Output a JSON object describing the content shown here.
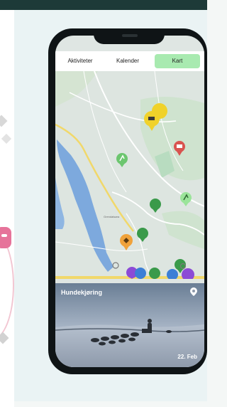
{
  "tabs": [
    {
      "label": "Aktiviteter",
      "active": false
    },
    {
      "label": "Kalender",
      "active": false
    },
    {
      "label": "Kart",
      "active": true
    }
  ],
  "map": {
    "road_label": "Grendalsøra",
    "markers": [
      {
        "icon": "event-pin-icon",
        "color": "#f0d22a"
      },
      {
        "icon": "food-pin-icon",
        "color": "#d9534f"
      },
      {
        "icon": "activity-pin-icon",
        "color": "#6cc66f"
      },
      {
        "icon": "activity-pin-icon",
        "color": "#9be49a"
      },
      {
        "icon": "activity-pin-icon",
        "color": "#3a9a4a"
      },
      {
        "icon": "activity-pin-icon",
        "color": "#3a9a4a"
      },
      {
        "icon": "orange-pin-icon",
        "color": "#f0a23a"
      },
      {
        "icon": "activity-pin-icon",
        "color": "#3a9a4a"
      },
      {
        "icon": "purple-pin-icon",
        "color": "#8c4bd6"
      },
      {
        "icon": "blue-pin-icon",
        "color": "#3c7fd6"
      },
      {
        "icon": "activity-pin-icon",
        "color": "#3a9a4a"
      },
      {
        "icon": "blue-pin-icon",
        "color": "#3c7fd6"
      },
      {
        "icon": "purple-pin-icon",
        "color": "#8c4bd6"
      },
      {
        "icon": "blue-pin-icon",
        "color": "#3c7fd6"
      }
    ]
  },
  "featured": {
    "title": "Hundekjøring",
    "date": "22. Feb"
  },
  "colors": {
    "accent": "#a8eab0",
    "phone": "#0f1416",
    "background": "#eaf3f4"
  }
}
